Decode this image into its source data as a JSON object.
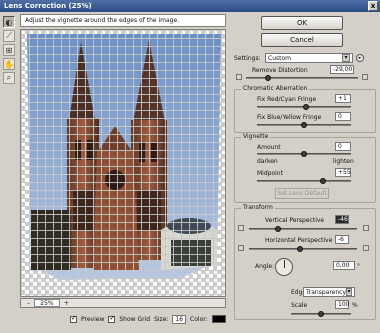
{
  "window": {
    "title": "Lens Correction (25%)",
    "close": "x"
  },
  "hint": "Adjust the vignette around the edges of the image.",
  "toolbar": {
    "tools": [
      "lens-icon",
      "straighten-icon",
      "grid-move-icon",
      "hand-icon",
      "zoom-icon"
    ]
  },
  "status": {
    "zoom_value": "25%",
    "minus": "–",
    "plus": "+"
  },
  "bottom": {
    "preview": "Preview",
    "show_grid": "Show Grid",
    "size_label": "Size:",
    "size_value": "16",
    "color_label": "Color:",
    "color": "#000000"
  },
  "buttons": {
    "ok": "OK",
    "cancel": "Cancel"
  },
  "settings": {
    "label": "Settings:",
    "value": "Custom"
  },
  "remove_distortion": {
    "label": "Remove Distortion",
    "value": "-29,00",
    "level": 0.2
  },
  "chromatic": {
    "title": "Chromatic Aberration",
    "red_cyan": {
      "label": "Fix Red/Cyan Fringe",
      "value": "+1",
      "level": 0.52
    },
    "blue_yellow": {
      "label": "Fix Blue/Yellow Fringe",
      "value": "0",
      "level": 0.5
    }
  },
  "vignette": {
    "title": "Vignette",
    "amount": {
      "label": "Amount",
      "value": "0",
      "level": 0.5
    },
    "darken": "darken",
    "lighten": "lighten",
    "midpoint": {
      "label": "Midpoint",
      "value": "+55",
      "level": 0.7
    },
    "set_default": "Set Lens Default"
  },
  "transform": {
    "title": "Transform",
    "vertical": {
      "label": "Vertical Perspective",
      "value": "-46",
      "level": 0.27
    },
    "horizontal": {
      "label": "Horizontal Perspective",
      "value": "-6",
      "level": 0.47
    },
    "angle": {
      "label": "Angle:",
      "value": "0,00",
      "unit": "°"
    },
    "edge": {
      "label": "Edge:",
      "value": "Transparency"
    },
    "scale": {
      "label": "Scale",
      "value": "100",
      "unit": "%",
      "level": 0.5
    }
  }
}
